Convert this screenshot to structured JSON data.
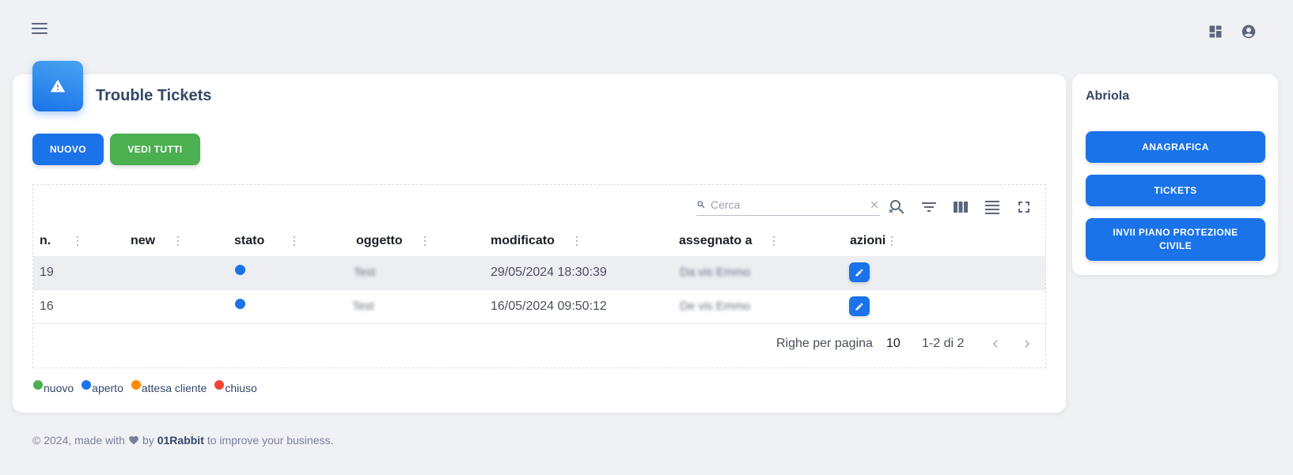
{
  "topbar": {
    "menu_icon": "menu-icon",
    "icons": [
      "dashboard-icon",
      "account-circle-icon"
    ]
  },
  "page": {
    "title": "Trouble Tickets",
    "header_icon": "warning-icon"
  },
  "actions": {
    "new_label": "NUOVO",
    "view_all_label": "VEDI TUTTI"
  },
  "search": {
    "placeholder": "Cerca",
    "value": ""
  },
  "toolbar_icons": [
    "search-reset-icon",
    "filter-icon",
    "columns-icon",
    "density-icon",
    "fullscreen-icon"
  ],
  "table": {
    "columns": [
      "n.",
      "new",
      "stato",
      "oggetto",
      "modificato",
      "assegnato a",
      "azioni"
    ],
    "rows": [
      {
        "n": "19",
        "new": "",
        "stato": "aperto",
        "oggetto": "Test",
        "modificato": "29/05/2024 18:30:39",
        "assegnato": "Da vis Emmo",
        "action_icon": "edit-icon"
      },
      {
        "n": "16",
        "new": "",
        "stato": "aperto",
        "oggetto": "Test",
        "modificato": "16/05/2024 09:50:12",
        "assegnato": "De vis Emmo",
        "action_icon": "edit-icon"
      }
    ]
  },
  "pagination": {
    "rows_per_page_label": "Righe per pagina",
    "rows_per_page": "10",
    "range": "1-2 di 2"
  },
  "legend": [
    {
      "label": "nuovo",
      "color": "#4caf50"
    },
    {
      "label": "aperto",
      "color": "#1a73e8"
    },
    {
      "label": "attesa cliente",
      "color": "#fb8c00"
    },
    {
      "label": "chiuso",
      "color": "#f44335"
    }
  ],
  "sidebar": {
    "title": "Abriola",
    "buttons": [
      "ANAGRAFICA",
      "TICKETS",
      "INVII PIANO PROTEZIONE CIVILE"
    ]
  },
  "footer": {
    "prefix": "© 2024, made with",
    "by": "by",
    "brand": "01Rabbit",
    "suffix": "to improve your business."
  },
  "colors": {
    "primary": "#1a73e8",
    "success": "#4caf50",
    "background": "#eff1f5"
  }
}
